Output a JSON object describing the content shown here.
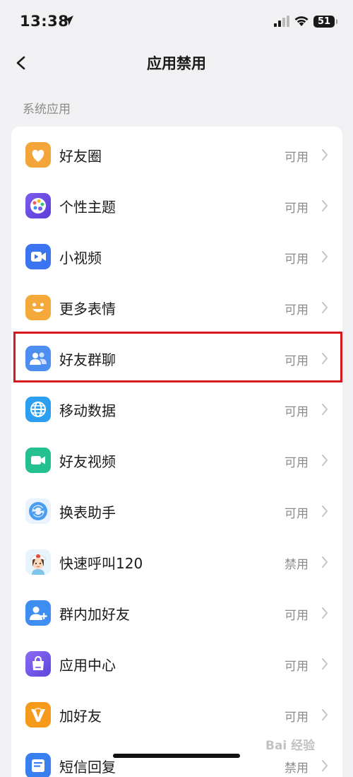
{
  "status_bar": {
    "time": "13:38",
    "battery": "51"
  },
  "nav": {
    "title": "应用禁用"
  },
  "section": {
    "label": "系统应用"
  },
  "items": [
    {
      "label": "好友圈",
      "state": "可用",
      "icon": "heart-icon"
    },
    {
      "label": "个性主题",
      "state": "可用",
      "icon": "palette-icon"
    },
    {
      "label": "小视频",
      "state": "可用",
      "icon": "video-icon"
    },
    {
      "label": "更多表情",
      "state": "可用",
      "icon": "smile-icon"
    },
    {
      "label": "好友群聊",
      "state": "可用",
      "icon": "group-chat-icon"
    },
    {
      "label": "移动数据",
      "state": "可用",
      "icon": "globe-icon"
    },
    {
      "label": "好友视频",
      "state": "可用",
      "icon": "video-call-icon"
    },
    {
      "label": "换表助手",
      "state": "可用",
      "icon": "swap-icon"
    },
    {
      "label": "快速呼叫120",
      "state": "禁用",
      "icon": "nurse-icon"
    },
    {
      "label": "群内加好友",
      "state": "可用",
      "icon": "add-friend-icon"
    },
    {
      "label": "应用中心",
      "state": "可用",
      "icon": "app-center-icon"
    },
    {
      "label": "加好友",
      "state": "可用",
      "icon": "add-friend-logo-icon"
    },
    {
      "label": "短信回复",
      "state": "禁用",
      "icon": "sms-icon"
    }
  ],
  "colors": {
    "highlight": "#d8181d",
    "background": "#f1f1f3",
    "secondary_text": "#8c8c8c"
  },
  "watermark": "Bai 经验"
}
